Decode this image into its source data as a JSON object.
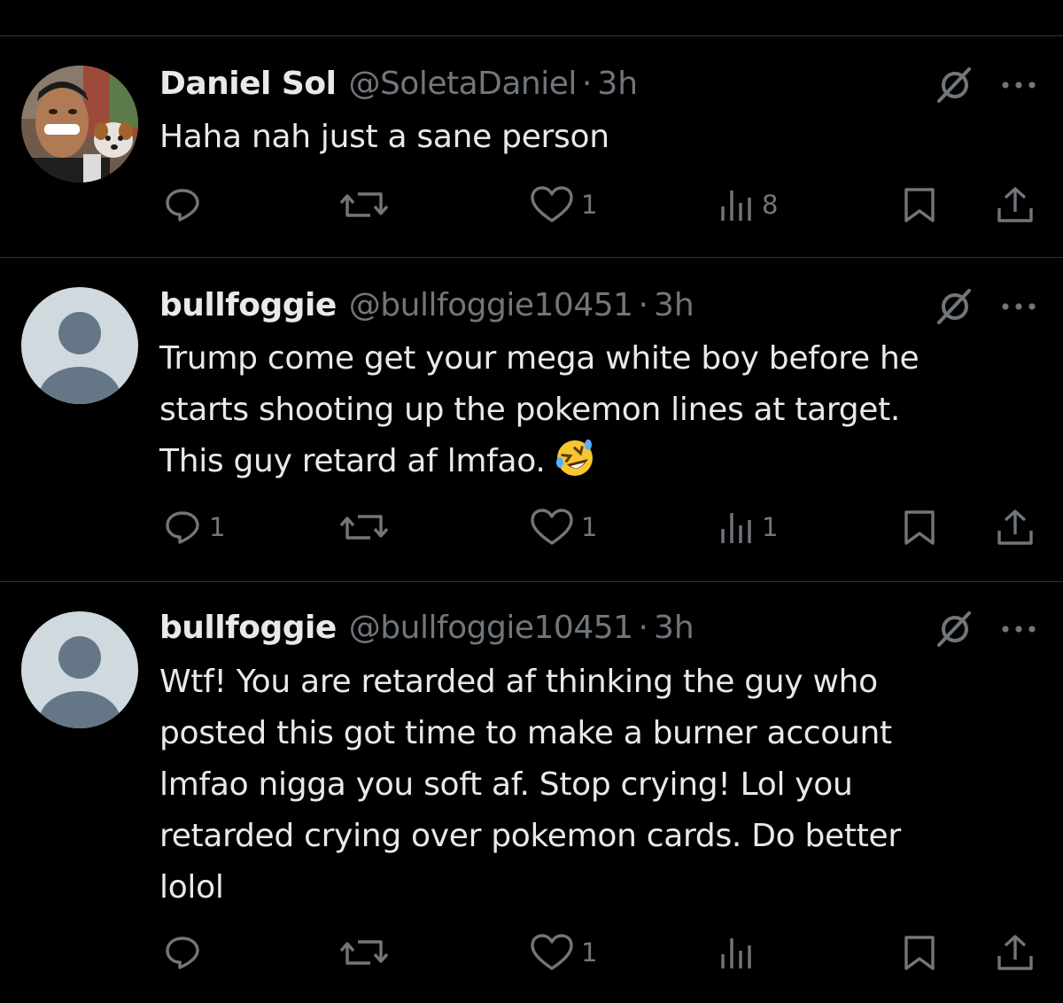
{
  "tweets": [
    {
      "display_name": "Daniel Sol",
      "handle": "@SoletaDaniel",
      "time": "3h",
      "separator": "·",
      "text": "Haha nah just a sane person",
      "avatar": "photo-avatar",
      "stats": {
        "replies": "",
        "reposts": "",
        "likes": "1",
        "views": "8"
      }
    },
    {
      "display_name": "bullfoggie",
      "handle": "@bullfoggie10451",
      "time": "3h",
      "separator": "·",
      "text": "Trump come get your mega white boy before he\nstarts shooting up the pokemon lines at target.\nThis guy retard af lmfao.",
      "emoji": "rolling-on-floor-laughing",
      "avatar": "default-avatar",
      "stats": {
        "replies": "1",
        "reposts": "",
        "likes": "1",
        "views": "1"
      }
    },
    {
      "display_name": "bullfoggie",
      "handle": "@bullfoggie10451",
      "time": "3h",
      "separator": "·",
      "text": "Wtf! You are retarded af thinking the guy who\nposted this got time to make a burner account\nlmfao nigga you soft af. Stop crying! Lol you\nretarded crying over pokemon cards. Do better\nlolol",
      "avatar": "default-avatar",
      "stats": {
        "replies": "",
        "reposts": "",
        "likes": "1",
        "views": ""
      }
    }
  ],
  "icons": [
    "reply-icon",
    "repost-icon",
    "like-icon",
    "views-icon",
    "bookmark-icon",
    "share-icon",
    "grok-icon",
    "more-icon"
  ],
  "colors": {
    "background": "#000000",
    "text_primary": "#e7e9ea",
    "text_secondary": "#71767b",
    "divider": "#2f3336",
    "default_avatar_bg": "#cfd9de",
    "default_avatar_fg": "#657786"
  }
}
